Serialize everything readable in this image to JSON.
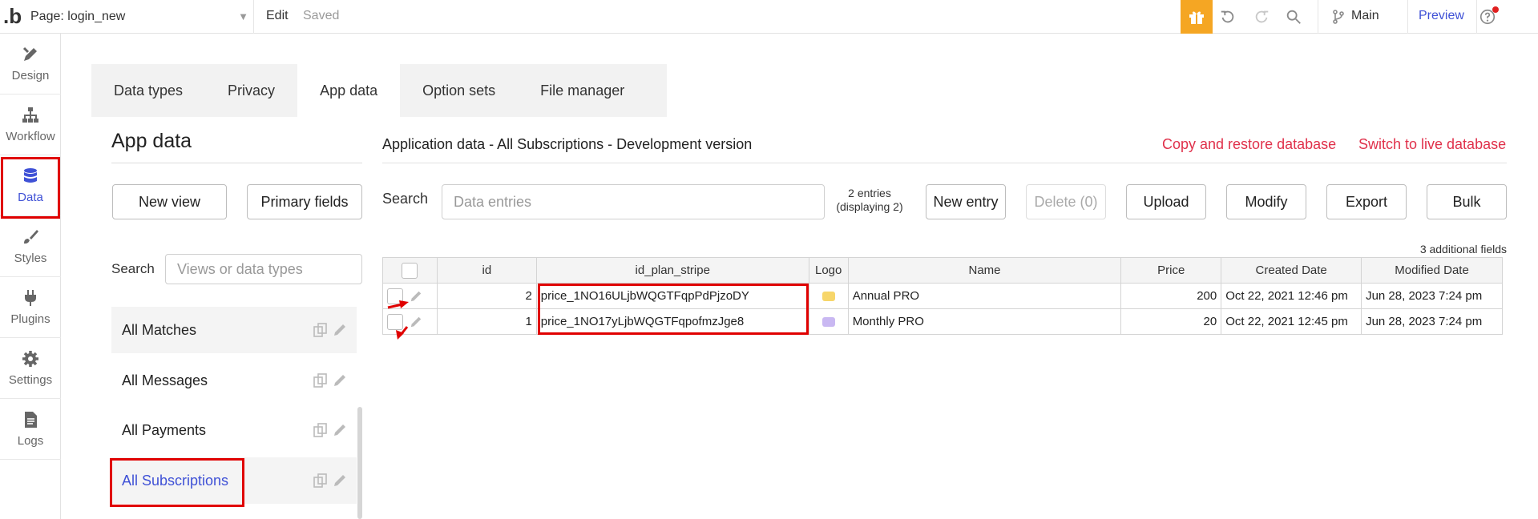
{
  "topbar": {
    "logo": ".b",
    "page_label": "Page: login_new",
    "edit": "Edit",
    "saved": "Saved",
    "branch": "Main",
    "preview": "Preview"
  },
  "sidebar": {
    "items": [
      {
        "label": "Design",
        "icon": "design-icon"
      },
      {
        "label": "Workflow",
        "icon": "workflow-icon"
      },
      {
        "label": "Data",
        "icon": "database-icon"
      },
      {
        "label": "Styles",
        "icon": "brush-icon"
      },
      {
        "label": "Plugins",
        "icon": "plug-icon"
      },
      {
        "label": "Settings",
        "icon": "gear-icon"
      },
      {
        "label": "Logs",
        "icon": "document-icon"
      }
    ]
  },
  "tabs": [
    "Data types",
    "Privacy",
    "App data",
    "Option sets",
    "File manager"
  ],
  "left": {
    "title": "App data",
    "new_view": "New view",
    "primary_fields": "Primary fields",
    "search_label": "Search",
    "search_placeholder": "Views or data types",
    "types": [
      "All Matches",
      "All Messages",
      "All Payments",
      "All Subscriptions"
    ]
  },
  "right": {
    "title": "Application data - All Subscriptions - Development version",
    "copy_restore": "Copy and restore database",
    "switch_live": "Switch to live database",
    "search_label": "Search",
    "search_placeholder": "Data entries",
    "entries_line1": "2 entries",
    "entries_line2": "(displaying 2)",
    "new_entry": "New entry",
    "delete": "Delete (0)",
    "upload": "Upload",
    "modify": "Modify",
    "export": "Export",
    "bulk": "Bulk",
    "additional_fields": "3 additional fields",
    "columns": [
      "id",
      "id_plan_stripe",
      "Logo",
      "Name",
      "Price",
      "Created Date",
      "Modified Date"
    ],
    "rows": [
      {
        "id": "2",
        "stripe": "price_1NO16ULjbWQGTFqpPdPjzoDY",
        "name": "Annual PRO",
        "price": "200",
        "created": "Oct 22, 2021 12:46 pm",
        "modified": "Jun 28, 2023 7:24 pm"
      },
      {
        "id": "1",
        "stripe": "price_1NO17yLjbWQGTFqpofmzJge8",
        "name": "Monthly PRO",
        "price": "20",
        "created": "Oct 22, 2021 12:45 pm",
        "modified": "Jun 28, 2023 7:24 pm"
      }
    ]
  },
  "colors": {
    "accent": "#3f51d6",
    "danger_link": "#e0314b",
    "highlight_box": "#e00000",
    "gift": "#f5a623"
  }
}
